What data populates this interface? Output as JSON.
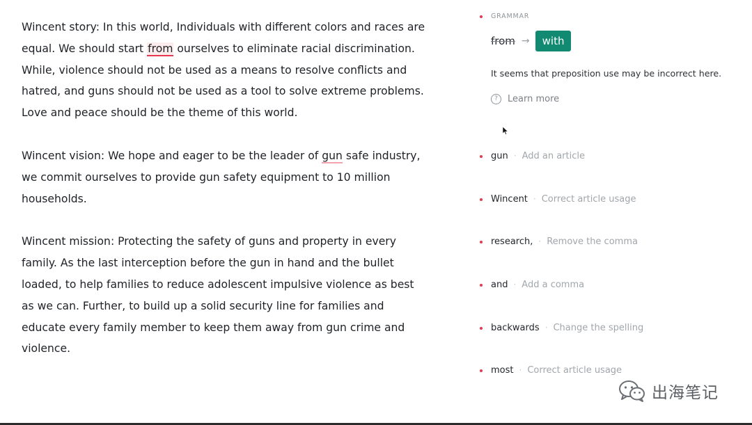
{
  "editor": {
    "p1": {
      "before": "Wincent story: In this world, Individuals with different colors and races are equal. We should start ",
      "flag": "from",
      "after": " ourselves to eliminate racial discrimination. While, violence should not be used as a means to resolve conflicts and hatred, and guns should not be used as a tool to solve extreme problems. Love and peace should be the theme of this world."
    },
    "p2": {
      "before": "Wincent vision: We hope and eager to be the leader of ",
      "flag": "gun",
      "after": " safe industry, we commit ourselves to provide gun safety equipment to 10 million households."
    },
    "p3": {
      "text": "Wincent mission: Protecting the safety of guns and property in every family. As the last interception before the gun in hand and the bullet loaded, to help families to reduce adolescent impulsive violence as best as we can. Further, to build up a solid security line for families and educate every family member to keep them away from gun crime and violence."
    }
  },
  "active_card": {
    "label": "GRAMMAR",
    "old_word": "from",
    "arrow": "→",
    "new_word": "with",
    "explanation": "It seems that preposition use may be incorrect here.",
    "learn_more": "Learn more",
    "help_icon": "question-circle-icon"
  },
  "suggestions": [
    {
      "word": "gun",
      "separator": "·",
      "description": "Add an article"
    },
    {
      "word": "Wincent",
      "separator": "·",
      "description": "Correct article usage"
    },
    {
      "word": "research,",
      "separator": "·",
      "description": "Remove the comma"
    },
    {
      "word": "and",
      "separator": "·",
      "description": "Add a comma"
    },
    {
      "word": "backwards",
      "separator": "·",
      "description": "Change the spelling"
    },
    {
      "word": "most",
      "separator": "·",
      "description": "Correct article usage"
    }
  ],
  "colors": {
    "alert_dot": "#e8384f",
    "accept_button": "#128a71",
    "underline": "#e8384f"
  },
  "watermark": {
    "icon": "wechat-icon",
    "text": "出海笔记"
  }
}
